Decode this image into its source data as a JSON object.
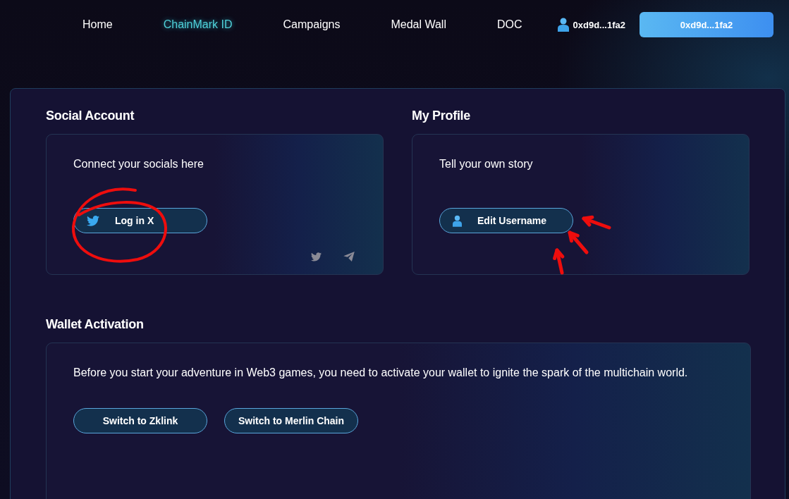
{
  "nav": {
    "items": [
      {
        "label": "Home",
        "selected": false
      },
      {
        "label": "ChainMark ID",
        "selected": true
      },
      {
        "label": "Campaigns",
        "selected": false
      },
      {
        "label": "Medal Wall",
        "selected": false
      },
      {
        "label": "DOC",
        "selected": false
      }
    ],
    "account": "0xd9d...1fa2",
    "wallet_button": "0xd9d...1fa2"
  },
  "social": {
    "title": "Social Account",
    "text": "Connect your socials here",
    "button": "Log in X"
  },
  "profile": {
    "title": "My Profile",
    "text": "Tell your own story",
    "button": "Edit Username"
  },
  "wallet": {
    "title": "Wallet Activation",
    "text": "Before you start your adventure in Web3 games, you need to activate your wallet to ignite the spark of the multichain world.",
    "buttons": [
      "Switch to Zklink",
      "Switch to Merlin Chain"
    ]
  },
  "annotations": [
    {
      "kind": "circle"
    },
    {
      "kind": "arrow"
    },
    {
      "kind": "arrow"
    },
    {
      "kind": "arrow"
    }
  ]
}
